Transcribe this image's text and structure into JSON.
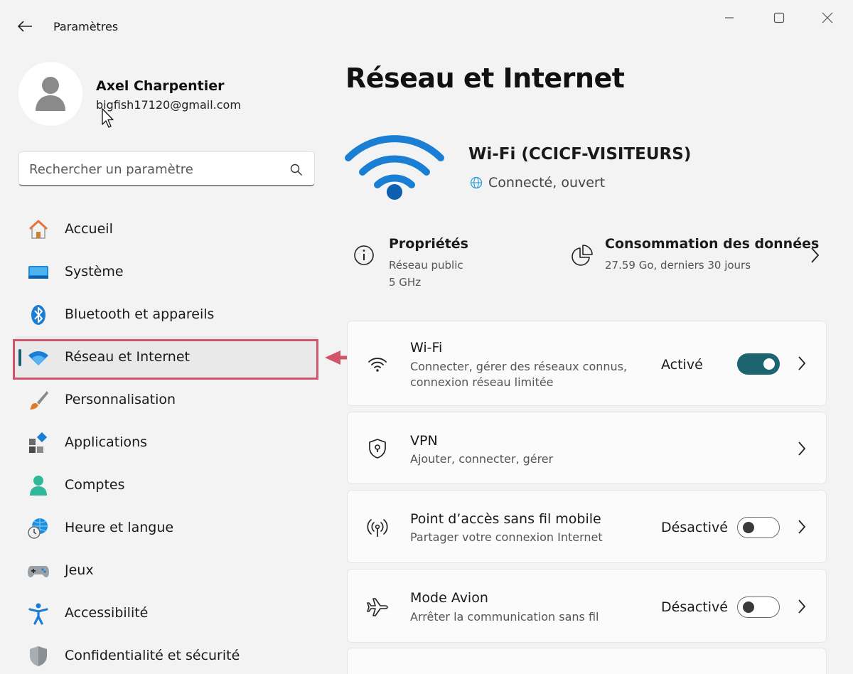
{
  "window": {
    "title": "Paramètres"
  },
  "profile": {
    "name": "Axel Charpentier",
    "email": "bigfish17120@gmail.com"
  },
  "search": {
    "placeholder": "Rechercher un paramètre"
  },
  "nav": {
    "items": [
      {
        "label": "Accueil",
        "icon": "home-icon"
      },
      {
        "label": "Système",
        "icon": "system-icon"
      },
      {
        "label": "Bluetooth et appareils",
        "icon": "bluetooth-icon"
      },
      {
        "label": "Réseau et Internet",
        "icon": "wifi-icon",
        "selected": true
      },
      {
        "label": "Personnalisation",
        "icon": "brush-icon"
      },
      {
        "label": "Applications",
        "icon": "apps-icon"
      },
      {
        "label": "Comptes",
        "icon": "account-icon"
      },
      {
        "label": "Heure et langue",
        "icon": "time-language-icon"
      },
      {
        "label": "Jeux",
        "icon": "gamepad-icon"
      },
      {
        "label": "Accessibilité",
        "icon": "accessibility-icon"
      },
      {
        "label": "Confidentialité et sécurité",
        "icon": "shield-icon"
      }
    ]
  },
  "main": {
    "title": "Réseau et Internet",
    "network": {
      "name": "Wi-Fi (CCICF-VISITEURS)",
      "status": "Connecté, ouvert"
    },
    "properties": {
      "title": "Propriétés",
      "line1": "Réseau public",
      "line2": "5 GHz"
    },
    "data_usage": {
      "title": "Consommation des données",
      "line1": "27.59 Go, derniers 30 jours"
    },
    "cards": {
      "wifi": {
        "title": "Wi-Fi",
        "sub1": "Connecter, gérer des réseaux connus,",
        "sub2": "connexion réseau limitée",
        "state": "Activé",
        "toggle_on": true
      },
      "vpn": {
        "title": "VPN",
        "sub1": "Ajouter, connecter, gérer"
      },
      "hotspot": {
        "title": "Point d’accès sans fil mobile",
        "sub1": "Partager votre connexion Internet",
        "state": "Désactivé",
        "toggle_on": false
      },
      "airplane": {
        "title": "Mode Avion",
        "sub1": "Arrêter la communication sans fil",
        "state": "Désactivé",
        "toggle_on": false
      }
    }
  },
  "colors": {
    "accent": "#1b6470",
    "wifi_blue": "#1a7fd4",
    "annotation": "#d0556a"
  }
}
